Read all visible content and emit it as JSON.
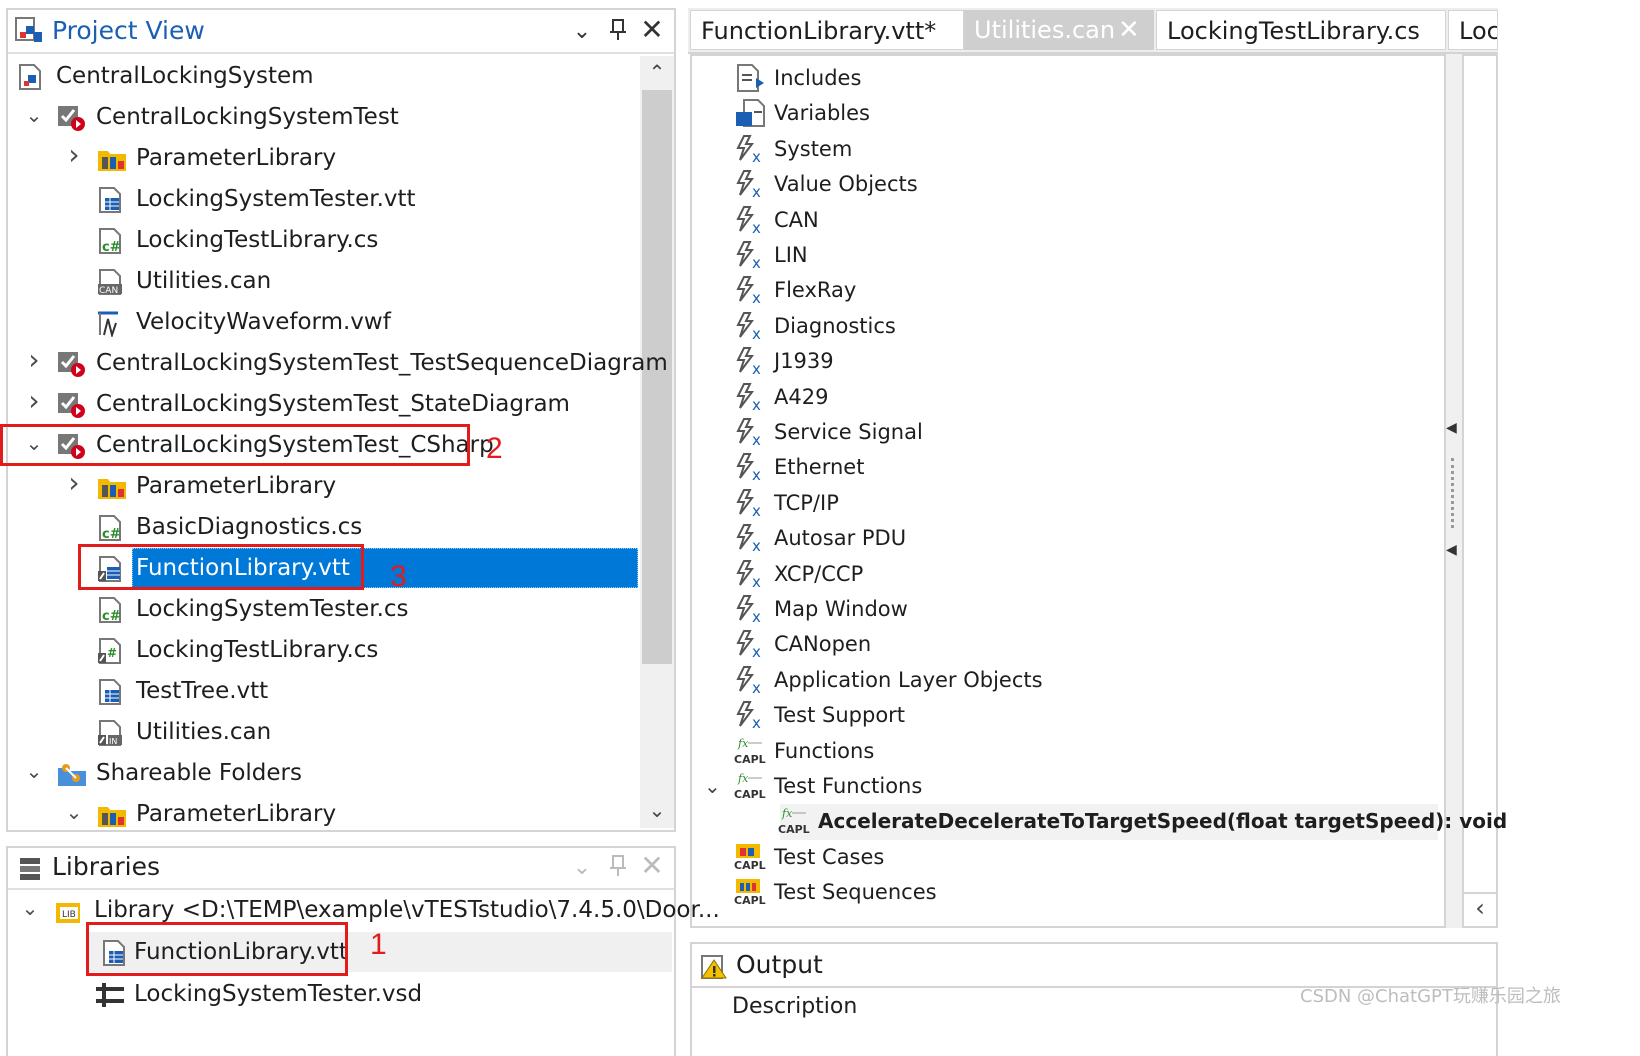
{
  "project_view": {
    "title": "Project View",
    "tree": [
      {
        "label": "CentralLockingSystem",
        "icon": "project-icon"
      },
      {
        "label": "CentralLockingSystemTest",
        "icon": "test-unit-icon",
        "expanded": true
      },
      {
        "label": "ParameterLibrary",
        "icon": "parameter-library-icon",
        "collapsed": true
      },
      {
        "label": "LockingSystemTester.vtt",
        "icon": "vtt-file-icon"
      },
      {
        "label": "LockingTestLibrary.cs",
        "icon": "csharp-file-icon"
      },
      {
        "label": "Utilities.can",
        "icon": "can-file-icon"
      },
      {
        "label": "VelocityWaveform.vwf",
        "icon": "waveform-file-icon"
      },
      {
        "label": "CentralLockingSystemTest_TestSequenceDiagram",
        "icon": "test-unit-icon",
        "collapsed": true
      },
      {
        "label": "CentralLockingSystemTest_StateDiagram",
        "icon": "test-unit-icon",
        "collapsed": true
      },
      {
        "label": "CentralLockingSystemTest_CSharp",
        "icon": "test-unit-icon",
        "expanded": true
      },
      {
        "label": "ParameterLibrary",
        "icon": "parameter-library-icon",
        "collapsed": true
      },
      {
        "label": "BasicDiagnostics.cs",
        "icon": "csharp-file-icon"
      },
      {
        "label": "FunctionLibrary.vtt",
        "icon": "vtt-link-file-icon",
        "selected": true
      },
      {
        "label": "LockingSystemTester.cs",
        "icon": "csharp-file-icon"
      },
      {
        "label": "LockingTestLibrary.cs",
        "icon": "csharp-link-file-icon"
      },
      {
        "label": "TestTree.vtt",
        "icon": "vtt-file-icon"
      },
      {
        "label": "Utilities.can",
        "icon": "can-link-file-icon"
      },
      {
        "label": "Shareable Folders",
        "icon": "shareable-folders-icon",
        "expanded": true
      },
      {
        "label": "ParameterLibrary",
        "icon": "parameter-library-icon",
        "expanded": true
      }
    ]
  },
  "libraries": {
    "title": "Libraries",
    "items": [
      {
        "label": "Library <D:\\TEMP\\example\\vTESTstudio\\7.4.5.0\\Door..."
      },
      {
        "label": "FunctionLibrary.vtt"
      },
      {
        "label": "LockingSystemTester.vsd"
      }
    ]
  },
  "annotations": {
    "one": "1",
    "two": "2",
    "three": "3"
  },
  "editor": {
    "tabs": [
      {
        "label": "FunctionLibrary.vtt*"
      },
      {
        "label": "Utilities.can",
        "active": true
      },
      {
        "label": "LockingTestLibrary.cs"
      },
      {
        "label": "Loc"
      }
    ],
    "items": [
      {
        "label": "Includes",
        "icon": "includes-icon"
      },
      {
        "label": "Variables",
        "icon": "variables-icon"
      },
      {
        "label": "System",
        "icon": "function-x-icon"
      },
      {
        "label": "Value Objects",
        "icon": "function-x-icon"
      },
      {
        "label": "CAN",
        "icon": "function-x-icon"
      },
      {
        "label": "LIN",
        "icon": "function-x-icon"
      },
      {
        "label": "FlexRay",
        "icon": "function-x-icon"
      },
      {
        "label": "Diagnostics",
        "icon": "function-x-icon"
      },
      {
        "label": "J1939",
        "icon": "function-x-icon"
      },
      {
        "label": "A429",
        "icon": "function-x-icon"
      },
      {
        "label": "Service Signal",
        "icon": "function-x-icon"
      },
      {
        "label": "Ethernet",
        "icon": "function-x-icon"
      },
      {
        "label": "TCP/IP",
        "icon": "function-x-icon"
      },
      {
        "label": "Autosar PDU",
        "icon": "function-x-icon"
      },
      {
        "label": "XCP/CCP",
        "icon": "function-x-icon"
      },
      {
        "label": "Map Window",
        "icon": "function-x-icon"
      },
      {
        "label": "CANopen",
        "icon": "function-x-icon"
      },
      {
        "label": "Application Layer Objects",
        "icon": "function-x-icon"
      },
      {
        "label": "Test Support",
        "icon": "function-x-icon"
      },
      {
        "label": "Functions",
        "icon": "capl-function-icon"
      },
      {
        "label": "Test Functions",
        "icon": "capl-function-icon",
        "expanded": true
      },
      {
        "label": "AccelerateDecelerateToTargetSpeed(float targetSpeed): void",
        "icon": "capl-function-icon",
        "bold": true
      },
      {
        "label": "Test Cases",
        "icon": "capl-testcase-icon"
      },
      {
        "label": "Test Sequences",
        "icon": "capl-sequence-icon"
      }
    ]
  },
  "output": {
    "title": "Output",
    "column": "Description"
  },
  "watermark": "CSDN @ChatGPT玩赚乐园之旅",
  "colors": {
    "selection": "#0078d7",
    "annotation": "#e21b1b",
    "link_blue": "#1a5fb4"
  }
}
